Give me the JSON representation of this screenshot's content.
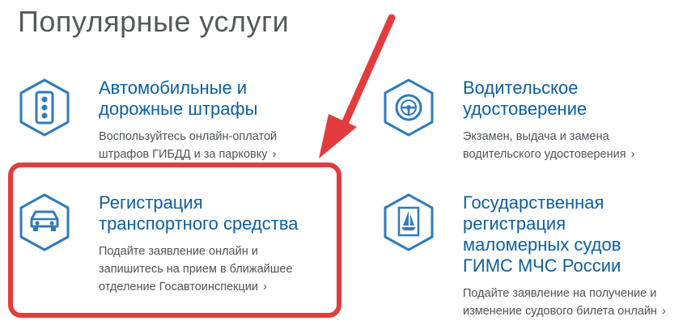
{
  "page_title": "Популярные услуги",
  "services": [
    {
      "icon": "traffic-light-icon",
      "title_lines": [
        "Автомобильные и",
        "дорожные штрафы"
      ],
      "desc_lines": [
        "Воспользуйтесь онлайн-оплатой",
        "штрафов ГИБДД и за парковку"
      ],
      "chevron": "›"
    },
    {
      "icon": "steering-wheel-icon",
      "title_lines": [
        "Водительское",
        "удостоверение"
      ],
      "desc_lines": [
        "Экзамен, выдача и замена",
        "водительского удостоверения"
      ],
      "chevron": "›"
    },
    {
      "icon": "car-icon",
      "title_lines": [
        "Регистрация",
        "транспортного средства"
      ],
      "desc_lines": [
        "Подайте заявление онлайн и",
        "запишитесь на прием в ближайшее",
        "отделение Госавтоинспекции"
      ],
      "chevron": "›"
    },
    {
      "icon": "sailboat-icon",
      "title_lines": [
        "Государственная",
        "регистрация",
        "маломерных судов",
        "ГИМС МЧС России"
      ],
      "desc_lines": [
        "Подайте заявление на получение и",
        "изменение судового билета онлайн"
      ],
      "chevron": "›"
    }
  ],
  "colors": {
    "title": "#55595e",
    "link": "#0d5fa0",
    "icon": "#2f7bbd",
    "highlight": "#e43c3e"
  }
}
